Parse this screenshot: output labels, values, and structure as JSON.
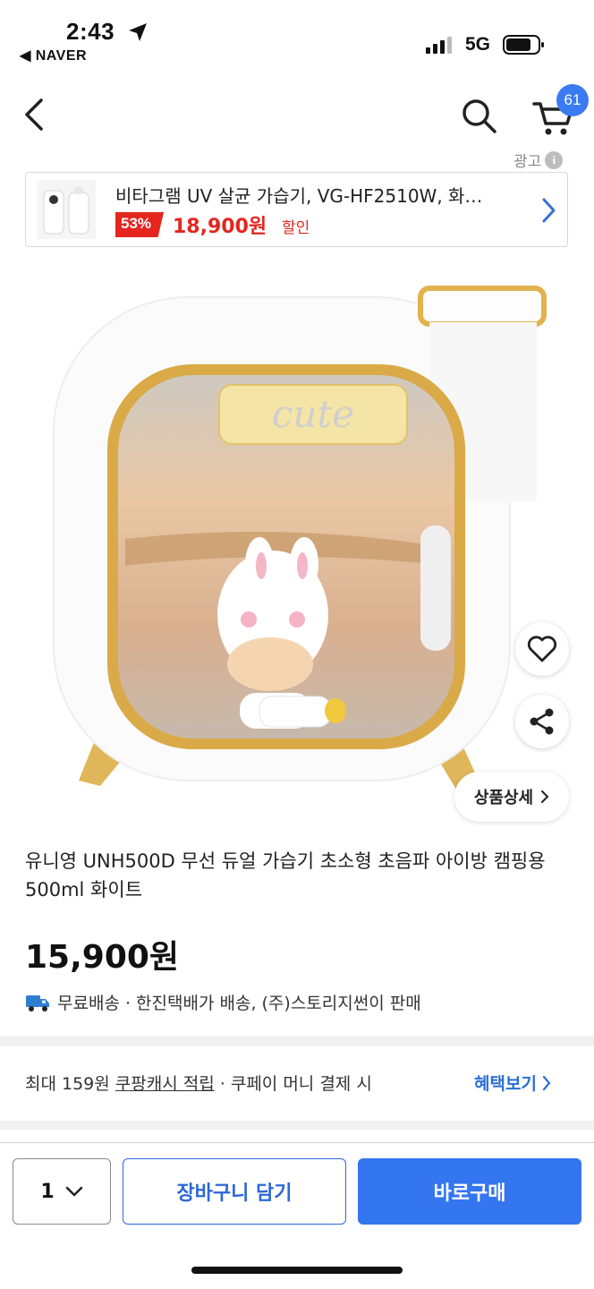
{
  "status_bar": {
    "time": "2:43",
    "back_app": "◀ NAVER",
    "network": "5G"
  },
  "nav": {
    "cart_count": "61"
  },
  "ad": {
    "label": "광고",
    "title": "비타그램 UV 살균 가습기, VG-HF2510W, 화…",
    "discount": "53%",
    "price": "18,900원",
    "sale_label": "할인"
  },
  "product": {
    "image_caption_text": "cute",
    "detail_button": "상품상세",
    "title": "유니영 UNH500D 무선 듀얼 가습기 초소형 초음파 아이방 캠핑용 500ml 화이트",
    "price": "15,900원",
    "shipping": "무료배송 · 한진택배가 배송, (주)스토리지썬이 판매"
  },
  "benefit": {
    "prefix": "최대 159원 ",
    "link_text": "쿠팡캐시 적립",
    "suffix": " · 쿠페이 머니 결제 시",
    "more": "혜택보기"
  },
  "bottom_bar": {
    "quantity": "1",
    "add_to_cart": "장바구니 담기",
    "buy_now": "바로구매"
  },
  "colors": {
    "accent_blue": "#3475f0",
    "sale_red": "#e4261f",
    "badge_blue": "#3a7bf2"
  }
}
